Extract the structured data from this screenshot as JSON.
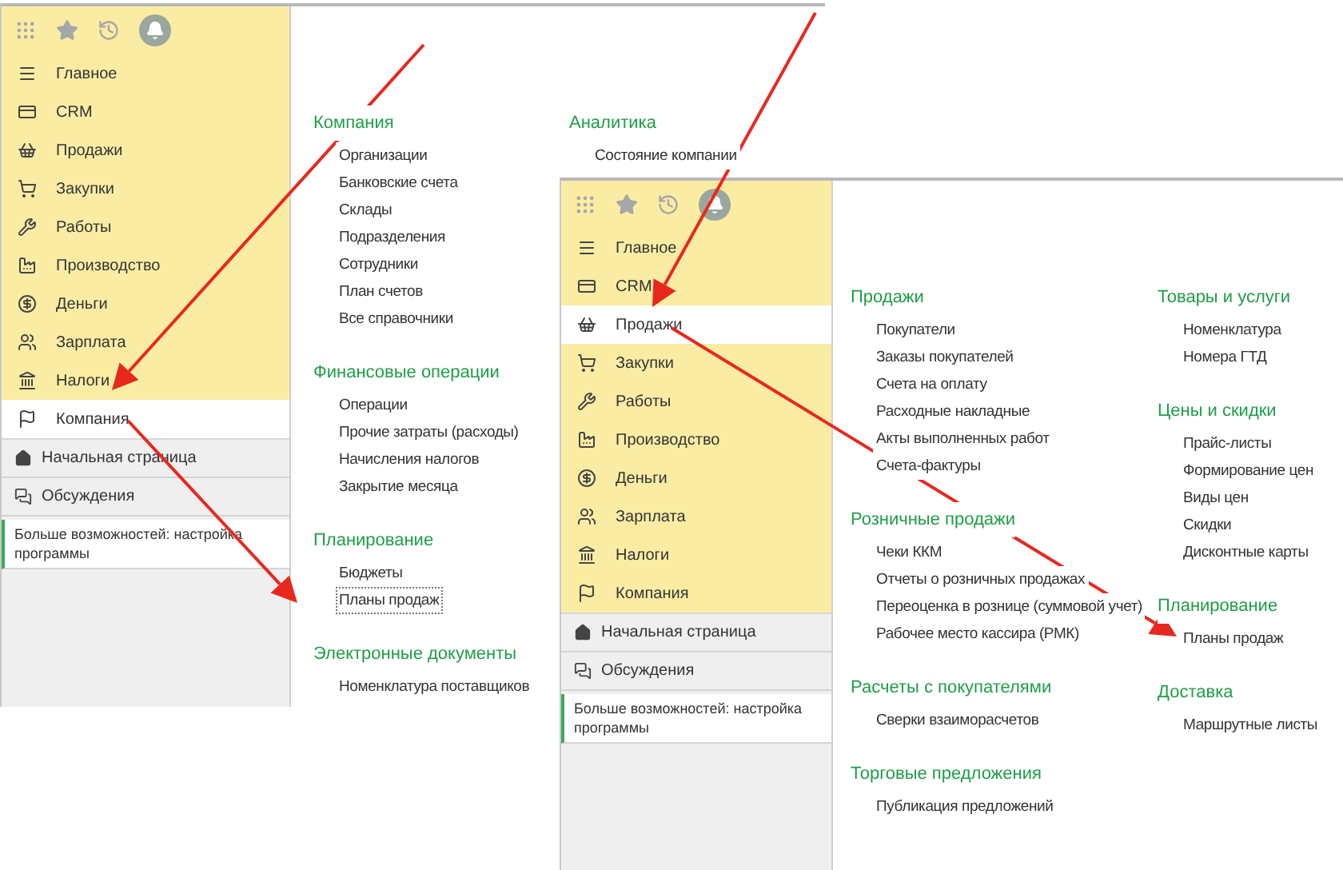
{
  "windows": [
    {
      "menu": [
        {
          "label": "Главное",
          "selected": false
        },
        {
          "label": "CRM",
          "selected": false
        },
        {
          "label": "Продажи",
          "selected": false
        },
        {
          "label": "Закупки",
          "selected": false
        },
        {
          "label": "Работы",
          "selected": false
        },
        {
          "label": "Производство",
          "selected": false
        },
        {
          "label": "Деньги",
          "selected": false
        },
        {
          "label": "Зарплата",
          "selected": false
        },
        {
          "label": "Налоги",
          "selected": false
        },
        {
          "label": "Компания",
          "selected": true
        }
      ],
      "bottom_links": [
        "Начальная страница",
        "Обсуждения"
      ],
      "hint": "Больше возможностей: настройка программы",
      "columns": [
        [
          {
            "title": "Компания",
            "items": [
              {
                "label": "Организации",
                "focused": false
              },
              {
                "label": "Банковские счета",
                "focused": false
              },
              {
                "label": "Склады",
                "focused": false
              },
              {
                "label": "Подразделения",
                "focused": false
              },
              {
                "label": "Сотрудники",
                "focused": false
              },
              {
                "label": "План счетов",
                "focused": false
              },
              {
                "label": "Все справочники",
                "focused": false
              }
            ]
          },
          {
            "title": "Финансовые операции",
            "items": [
              {
                "label": "Операции",
                "focused": false
              },
              {
                "label": "Прочие затраты (расходы)",
                "focused": false
              },
              {
                "label": "Начисления налогов",
                "focused": false
              },
              {
                "label": "Закрытие месяца",
                "focused": false
              }
            ]
          },
          {
            "title": "Планирование",
            "items": [
              {
                "label": "Бюджеты",
                "focused": false
              },
              {
                "label": "Планы продаж",
                "focused": true
              }
            ]
          },
          {
            "title": "Электронные документы",
            "items": [
              {
                "label": "Номенклатура поставщиков",
                "focused": false
              }
            ]
          }
        ],
        [
          {
            "title": "Аналитика",
            "items": [
              {
                "label": "Состояние компании",
                "focused": false
              }
            ]
          }
        ]
      ]
    },
    {
      "menu": [
        {
          "label": "Главное",
          "selected": false
        },
        {
          "label": "CRM",
          "selected": false
        },
        {
          "label": "Продажи",
          "selected": true
        },
        {
          "label": "Закупки",
          "selected": false
        },
        {
          "label": "Работы",
          "selected": false
        },
        {
          "label": "Производство",
          "selected": false
        },
        {
          "label": "Деньги",
          "selected": false
        },
        {
          "label": "Зарплата",
          "selected": false
        },
        {
          "label": "Налоги",
          "selected": false
        },
        {
          "label": "Компания",
          "selected": false
        }
      ],
      "bottom_links": [
        "Начальная страница",
        "Обсуждения"
      ],
      "hint": "Больше возможностей: настройка программы",
      "columns": [
        [
          {
            "title": "Продажи",
            "items": [
              {
                "label": "Покупатели",
                "focused": false
              },
              {
                "label": "Заказы покупателей",
                "focused": false
              },
              {
                "label": "Счета на оплату",
                "focused": false
              },
              {
                "label": "Расходные накладные",
                "focused": false
              },
              {
                "label": "Акты выполненных работ",
                "focused": false
              },
              {
                "label": "Счета-фактуры",
                "focused": false
              }
            ]
          },
          {
            "title": "Розничные продажи",
            "items": [
              {
                "label": "Чеки ККМ",
                "focused": false
              },
              {
                "label": "Отчеты о розничных продажах",
                "focused": false
              },
              {
                "label": "Переоценка в рознице (суммовой учет)",
                "focused": false
              },
              {
                "label": "Рабочее место кассира (РМК)",
                "focused": false
              }
            ]
          },
          {
            "title": "Расчеты с покупателями",
            "items": [
              {
                "label": "Сверки взаиморасчетов",
                "focused": false
              }
            ]
          },
          {
            "title": "Торговые предложения",
            "items": [
              {
                "label": "Публикация предложений",
                "focused": false
              }
            ]
          }
        ],
        [
          {
            "title": "Товары и услуги",
            "items": [
              {
                "label": "Номенклатура",
                "focused": false
              },
              {
                "label": "Номера ГТД",
                "focused": false
              }
            ]
          },
          {
            "title": "Цены и скидки",
            "items": [
              {
                "label": "Прайс-листы",
                "focused": false
              },
              {
                "label": "Формирование цен",
                "focused": false
              },
              {
                "label": "Виды цен",
                "focused": false
              },
              {
                "label": "Скидки",
                "focused": false
              },
              {
                "label": "Дисконтные карты",
                "focused": false
              }
            ]
          },
          {
            "title": "Планирование",
            "items": [
              {
                "label": "Планы продаж",
                "focused": false
              }
            ]
          },
          {
            "title": "Доставка",
            "items": [
              {
                "label": "Маршрутные листы",
                "focused": false
              }
            ]
          }
        ]
      ]
    }
  ]
}
